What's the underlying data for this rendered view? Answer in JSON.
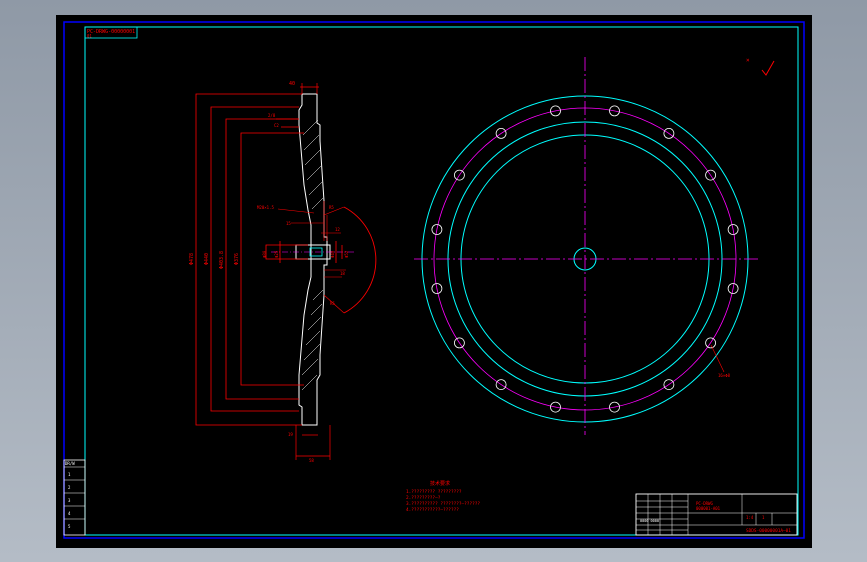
{
  "drawing": {
    "top_left_tag": "PC-DRWG-00000001",
    "sheet_number": "01",
    "roughness_mark": "√",
    "side_view": {
      "dim_top": "40",
      "dim_left": "2/8",
      "dim_chamfer": "C2",
      "dim_bottom_1": "19",
      "dim_bottom_2": "58",
      "dim_hub_1": "15",
      "dim_hub_2": "12",
      "dim_hub_3": "18",
      "leader_note": "M20×1.5",
      "dia_1": "Φ478",
      "dia_2": "Φ440",
      "dia_3": "Φ403.8",
      "dia_4": "Φ376",
      "hub_dia_1": "Φ80",
      "hub_dia_2": "Φ25",
      "hub_dia_3": "Φ40",
      "hub_dia_4": "Φ52"
    },
    "front_view": {
      "hole_note": "16×Φ8"
    },
    "notes": {
      "heading": "技术要求",
      "lines": [
        "1.????????? ?????????",
        "2.?????????—?",
        "3.?????????? ????????—??????",
        "4.???????????—??????"
      ]
    },
    "title_block": {
      "title_line_1": "PC-DRWG",
      "title_line_2": "000001-A01",
      "drawing_code": "SDDS-00000001A—01",
      "scale": "1:4",
      "sheet": "1"
    },
    "left_strip": {
      "header": "DR/W",
      "cells": [
        "1",
        "2",
        "3",
        "4",
        "5"
      ]
    }
  },
  "colors": {
    "background": "#000000",
    "outline": "#0000ff",
    "frame": "#00ffff",
    "dimension": "#ff0000",
    "centerline": "#ff00ff",
    "text": "#ffffff"
  }
}
